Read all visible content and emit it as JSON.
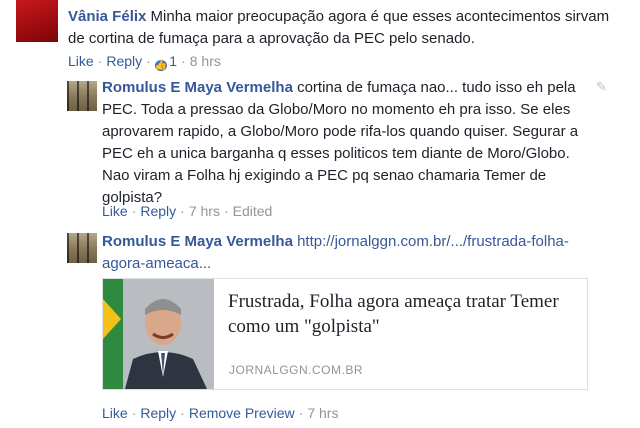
{
  "comment1": {
    "author": "Vânia Félix",
    "text": "Minha maior preocupação agora é que esses acontecimentos sirvam de cortina de fumaça para a aprovação da PEC pelo senado.",
    "actions": {
      "like": "Like",
      "reply": "Reply",
      "reaction_count": "1",
      "time": "8 hrs"
    }
  },
  "reply1": {
    "author": "Romulus E Maya Vermelha",
    "text": "cortina de fumaça nao... tudo isso eh pela PEC. Toda a pressao da Globo/Moro no momento eh pra isso. Se eles aprovarem rapido, a Globo/Moro pode rifa-los quando quiser. Segurar a PEC eh a unica barganha q esses politicos tem diante de Moro/Globo. Nao viram a Folha hj exigindo a PEC pq senao chamaria Temer de golpista?",
    "actions": {
      "like": "Like",
      "reply": "Reply",
      "time": "7 hrs",
      "edited": "Edited"
    }
  },
  "reply2": {
    "author": "Romulus E Maya Vermelha",
    "link_text": "http://jornalggn.com.br/.../frustrada-folha-agora-ameaca...",
    "preview": {
      "title": "Frustrada, Folha agora ameaça tratar Temer como um \"golpista\"",
      "domain": "JORNALGGN.COM.BR"
    },
    "actions": {
      "like": "Like",
      "reply": "Reply",
      "remove_preview": "Remove Preview",
      "time": "7 hrs"
    }
  },
  "colors": {
    "link_blue": "#365899",
    "meta_gray": "#90949c",
    "text": "#1d2129",
    "like_badge": "#4a76c8"
  }
}
